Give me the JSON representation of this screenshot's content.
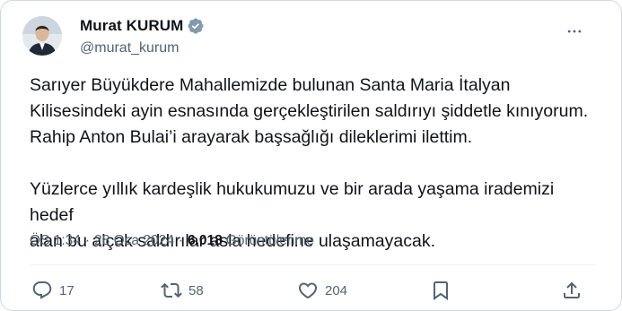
{
  "author": {
    "display_name": "Murat KURUM",
    "handle": "@murat_kurum",
    "verified": true,
    "verified_color": "#829aab"
  },
  "tweet": {
    "lines_p1": [
      "Sarıyer Büyükdere Mahallemizde bulunan Santa Maria İtalyan",
      "Kilisesindeki ayin esnasında gerçekleştirilen saldırıyı şiddetle kınıyorum.",
      "Rahip Anton Bulai’i arayarak başsağlığı dileklerimi ilettim."
    ],
    "lines_p2": [
      "Yüzlerce yıllık kardeşlik hukukumuzu ve bir arada yaşama irademizi hedef",
      "alan bu alçak saldırılar asla hedefine ulaşamayacak."
    ]
  },
  "meta": {
    "time": "ÖS 1:34",
    "date": "28 Oca 2024",
    "separator": "·",
    "views_count": "6.018",
    "views_label": "Görüntülenme"
  },
  "actions": {
    "reply_count": "17",
    "retweet_count": "58",
    "like_count": "204"
  },
  "icons": {
    "more": "more-horizontal-icon",
    "reply": "reply-icon",
    "retweet": "retweet-icon",
    "like": "heart-icon",
    "bookmark": "bookmark-icon",
    "share": "share-icon",
    "verified": "verified-badge-icon"
  },
  "colors": {
    "text": "#0f1419",
    "secondary": "#536471",
    "border": "#cfd9de"
  }
}
